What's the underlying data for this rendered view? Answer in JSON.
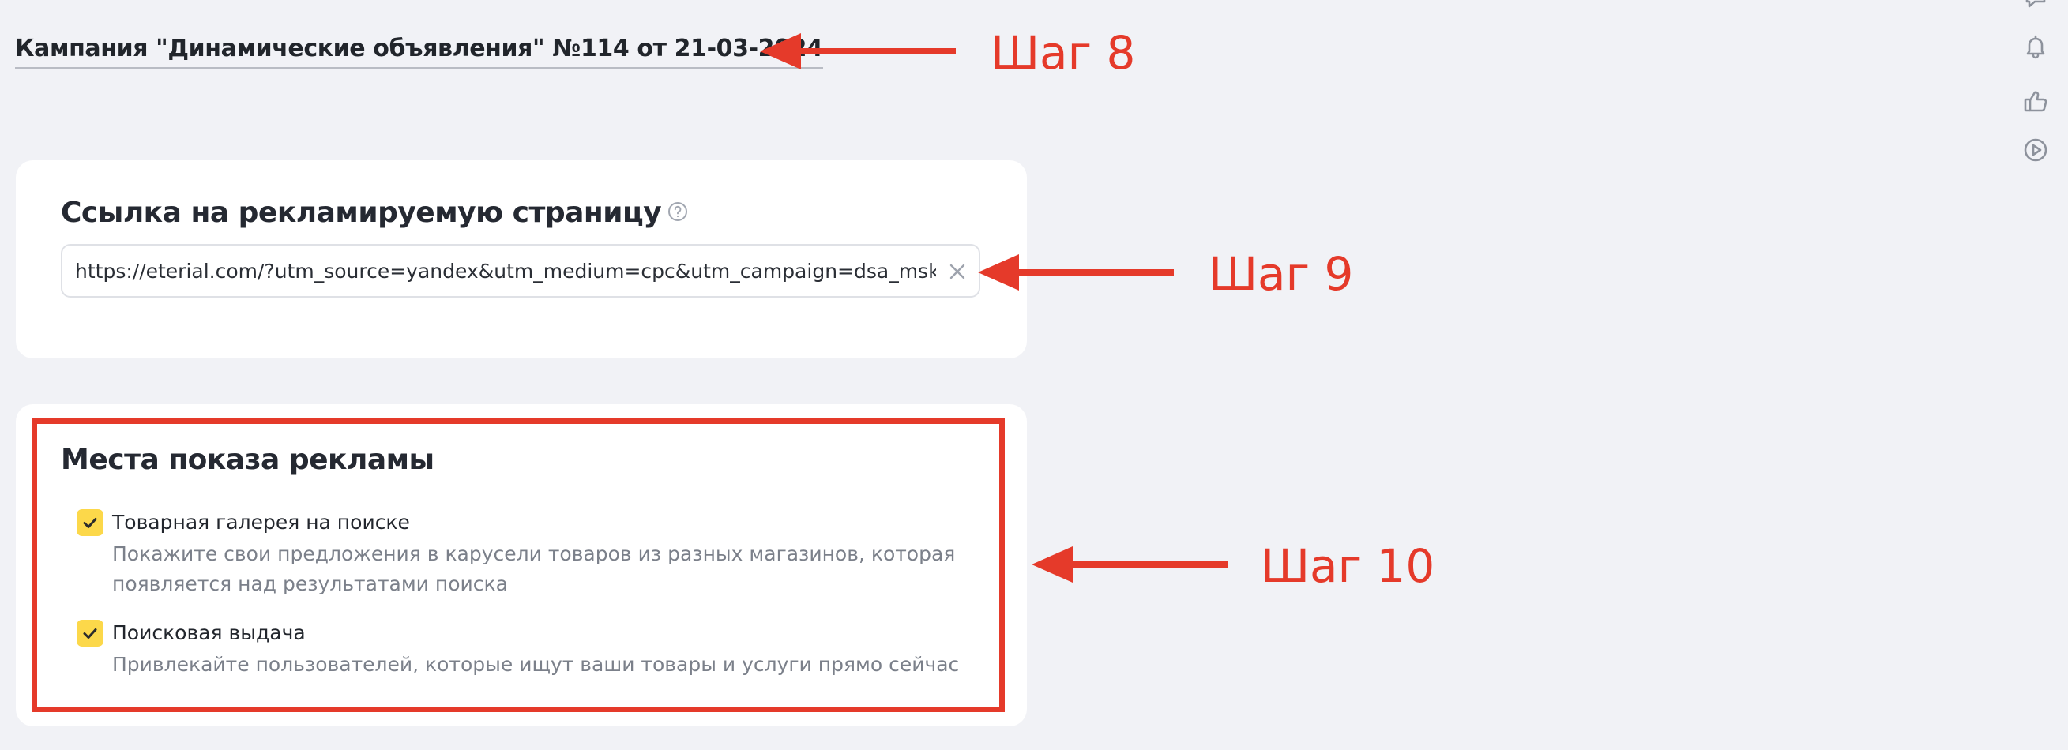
{
  "campaign": {
    "title": "Кампания \"Динамические объявления\" №114 от 21-03-2024"
  },
  "link_section": {
    "heading": "Ссылка на рекламируемую страницу",
    "url_value": "https://eterial.com/?utm_source=yandex&utm_medium=cpc&utm_campaign=dsa_msk&utm_cc"
  },
  "placements_section": {
    "heading": "Места показа рекламы",
    "options": [
      {
        "title": "Товарная галерея на поиске",
        "description": "Покажите свои предложения в карусели товаров из разных магазинов, которая появляется над результатами поиска",
        "checked": true
      },
      {
        "title": "Поисковая выдача",
        "description": "Привлекайте пользователей, которые ищут ваши товары и услуги прямо сейчас",
        "checked": true
      }
    ]
  },
  "annotations": {
    "step_8": "Шаг 8",
    "step_9": "Шаг 9",
    "step_10": "Шаг 10",
    "color": "#e53a2a"
  },
  "side_icons": [
    "chat-icon",
    "bell-icon",
    "thumbs-up-icon",
    "play-icon"
  ],
  "colors": {
    "background": "#f1f2f6",
    "card": "#ffffff",
    "checkbox": "#fcd84a",
    "annotation": "#e53a2a"
  }
}
